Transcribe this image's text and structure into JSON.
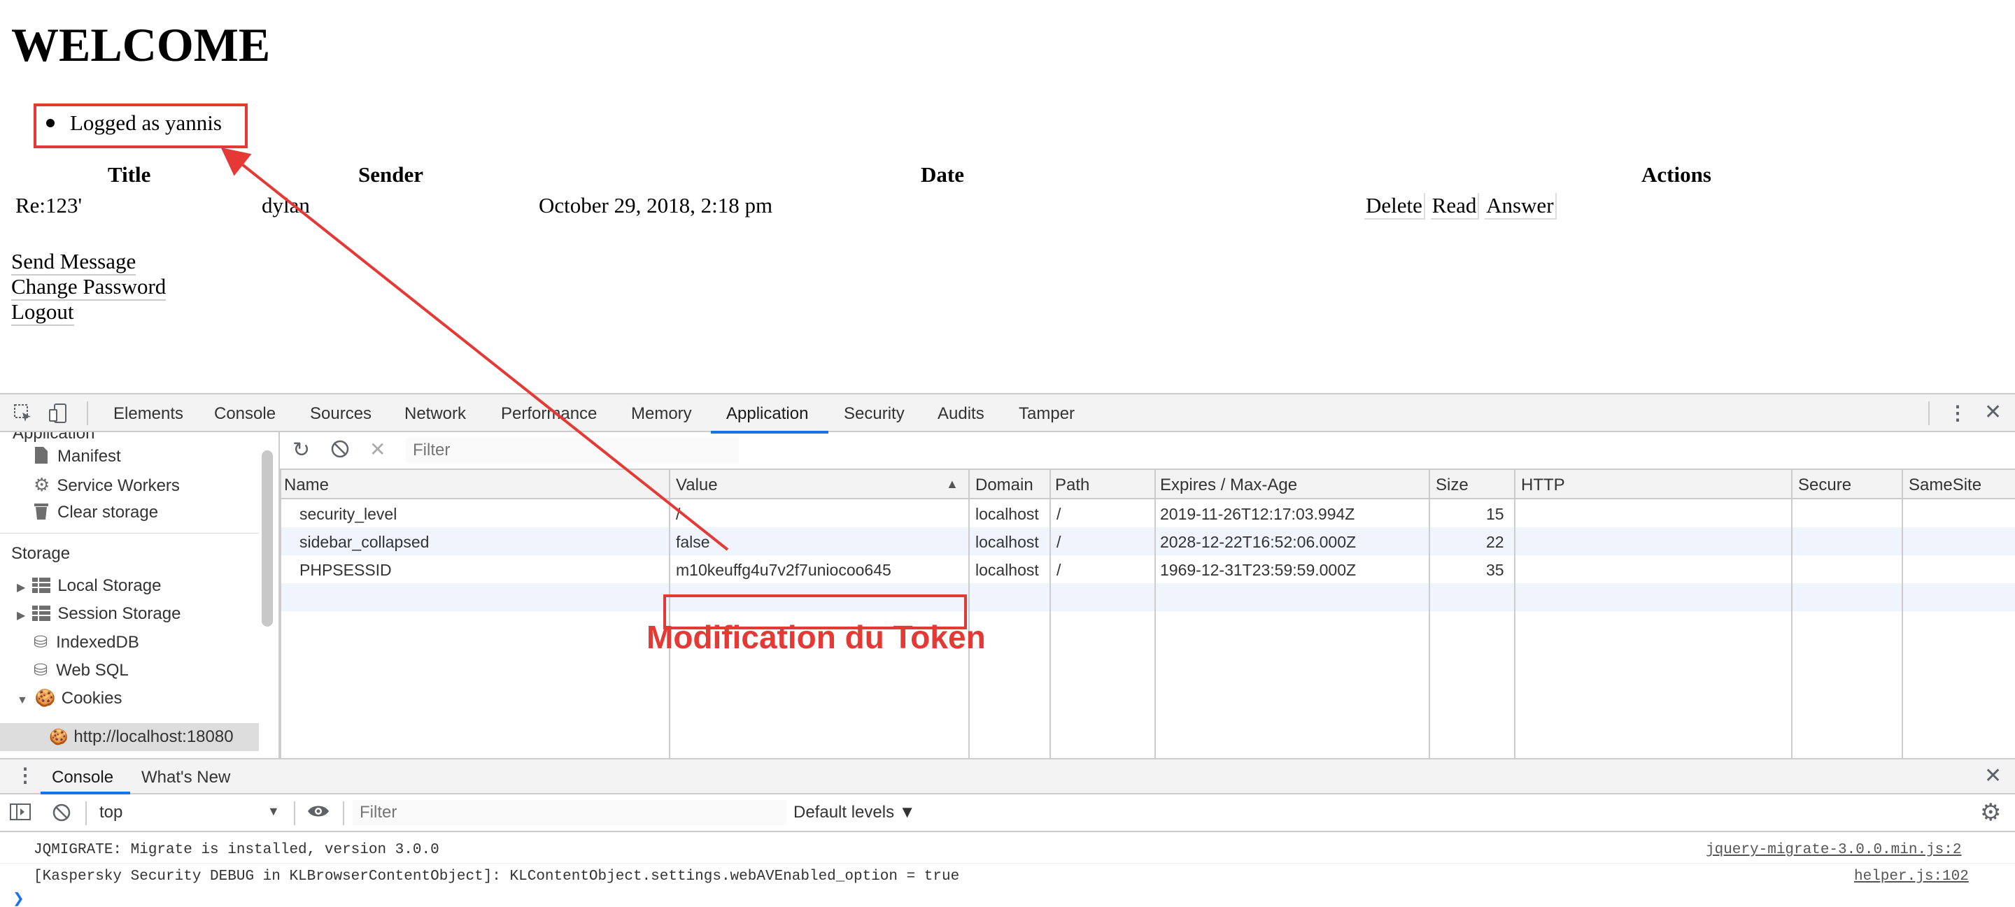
{
  "page": {
    "heading": "WELCOME",
    "logged_text": "Logged as yannis",
    "table": {
      "headers": [
        "Title",
        "Sender",
        "Date",
        "Actions"
      ],
      "rows": [
        {
          "title": "Re:123'",
          "sender": "dylan",
          "date": "October 29, 2018, 2:18 pm",
          "actions": [
            "Delete",
            "Read",
            "Answer"
          ]
        }
      ]
    },
    "links": [
      "Send Message",
      "Change Password",
      "Logout"
    ]
  },
  "devtools": {
    "tabs": [
      "Elements",
      "Console",
      "Sources",
      "Network",
      "Performance",
      "Memory",
      "Application",
      "Security",
      "Audits",
      "Tamper"
    ],
    "active_tab": "Application",
    "sidebar": {
      "partial_header": "Application",
      "app_items": [
        "Manifest",
        "Service Workers",
        "Clear storage"
      ],
      "storage_header": "Storage",
      "storage_items": [
        "Local Storage",
        "Session Storage",
        "IndexedDB",
        "Web SQL",
        "Cookies"
      ],
      "cookie_origin": "http://localhost:18080"
    },
    "cookies": {
      "filter_placeholder": "Filter",
      "columns": [
        "Name",
        "Value",
        "Domain",
        "Path",
        "Expires / Max-Age",
        "Size",
        "HTTP",
        "Secure",
        "SameSite"
      ],
      "rows": [
        {
          "name": "security_level",
          "value": "/",
          "domain": "localhost",
          "path": "/",
          "expires": "2019-11-26T12:17:03.994Z",
          "size": "15"
        },
        {
          "name": "sidebar_collapsed",
          "value": "false",
          "domain": "localhost",
          "path": "/",
          "expires": "2028-12-22T16:52:06.000Z",
          "size": "22"
        },
        {
          "name": "PHPSESSID",
          "value": "m10keuffg4u7v2f7uniocoo645",
          "domain": "localhost",
          "path": "/",
          "expires": "1969-12-31T23:59:59.000Z",
          "size": "35"
        }
      ]
    },
    "drawer": {
      "tabs": [
        "Console",
        "What's New"
      ],
      "context": "top",
      "filter_placeholder": "Filter",
      "levels": "Default levels ▼",
      "messages": [
        {
          "text": "JQMIGRATE: Migrate is installed, version 3.0.0",
          "source": "jquery-migrate-3.0.0.min.js:2"
        },
        {
          "text": "[Kaspersky Security DEBUG in KLBrowserContentObject]: KLContentObject.settings.webAVEnabled_option = true",
          "source": "helper.js:102"
        }
      ]
    }
  },
  "annotation": {
    "text": "Modification du Token",
    "color": "#e53935"
  }
}
